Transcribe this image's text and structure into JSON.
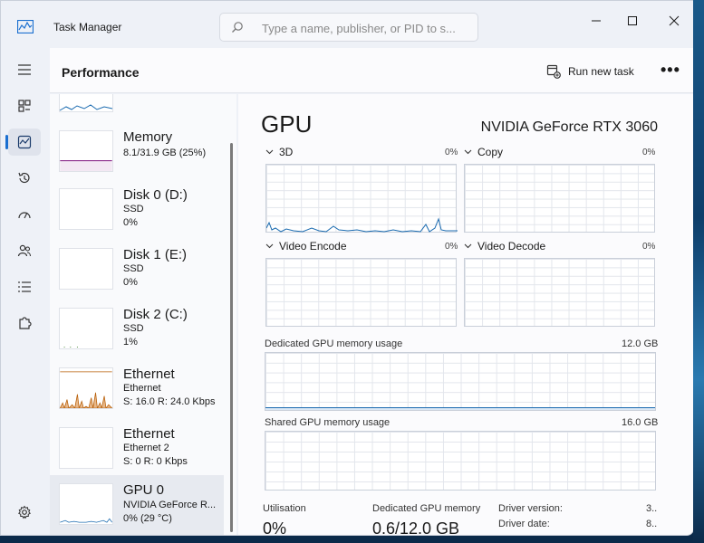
{
  "window": {
    "title": "Task Manager",
    "search_placeholder": "Type a name, publisher, or PID to s..."
  },
  "header": {
    "title": "Performance",
    "run_task_label": "Run new task",
    "more_label": "•••"
  },
  "devices": [
    {
      "name": "Memory",
      "sub1": "8.1/31.9 GB (25%)",
      "sub2": ""
    },
    {
      "name": "Disk 0 (D:)",
      "sub1": "SSD",
      "sub2": "0%"
    },
    {
      "name": "Disk 1 (E:)",
      "sub1": "SSD",
      "sub2": "0%"
    },
    {
      "name": "Disk 2 (C:)",
      "sub1": "SSD",
      "sub2": "1%"
    },
    {
      "name": "Ethernet",
      "sub1": "Ethernet",
      "sub2": "S: 16.0  R: 24.0 Kbps"
    },
    {
      "name": "Ethernet",
      "sub1": "Ethernet 2",
      "sub2": "S: 0  R: 0 Kbps"
    },
    {
      "name": "GPU 0",
      "sub1": "NVIDIA GeForce R...",
      "sub2": "0% (29 °C)"
    }
  ],
  "detail": {
    "title": "GPU",
    "model": "NVIDIA GeForce RTX 3060",
    "engines": [
      {
        "name": "3D",
        "pct": "0%"
      },
      {
        "name": "Copy",
        "pct": "0%"
      },
      {
        "name": "Video Encode",
        "pct": "0%"
      },
      {
        "name": "Video Decode",
        "pct": "0%"
      }
    ],
    "dedicated_label": "Dedicated GPU memory usage",
    "dedicated_max": "12.0 GB",
    "shared_label": "Shared GPU memory usage",
    "shared_max": "16.0 GB",
    "stats": {
      "util_label": "Utilisation",
      "util_value": "0%",
      "dedmem_label": "Dedicated GPU memory",
      "dedmem_value": "0.6/12.0 GB",
      "driver_version_label": "Driver version:",
      "driver_version_value": "3..",
      "driver_date_label": "Driver date:",
      "driver_date_value": "8.."
    }
  },
  "colors": {
    "accent": "#1a6fd0",
    "memory_graph": "#8b2d8b",
    "disk_graph": "#4a8a3a",
    "ethernet_graph": "#b8600a",
    "gpu_graph": "#1b6bb0"
  }
}
